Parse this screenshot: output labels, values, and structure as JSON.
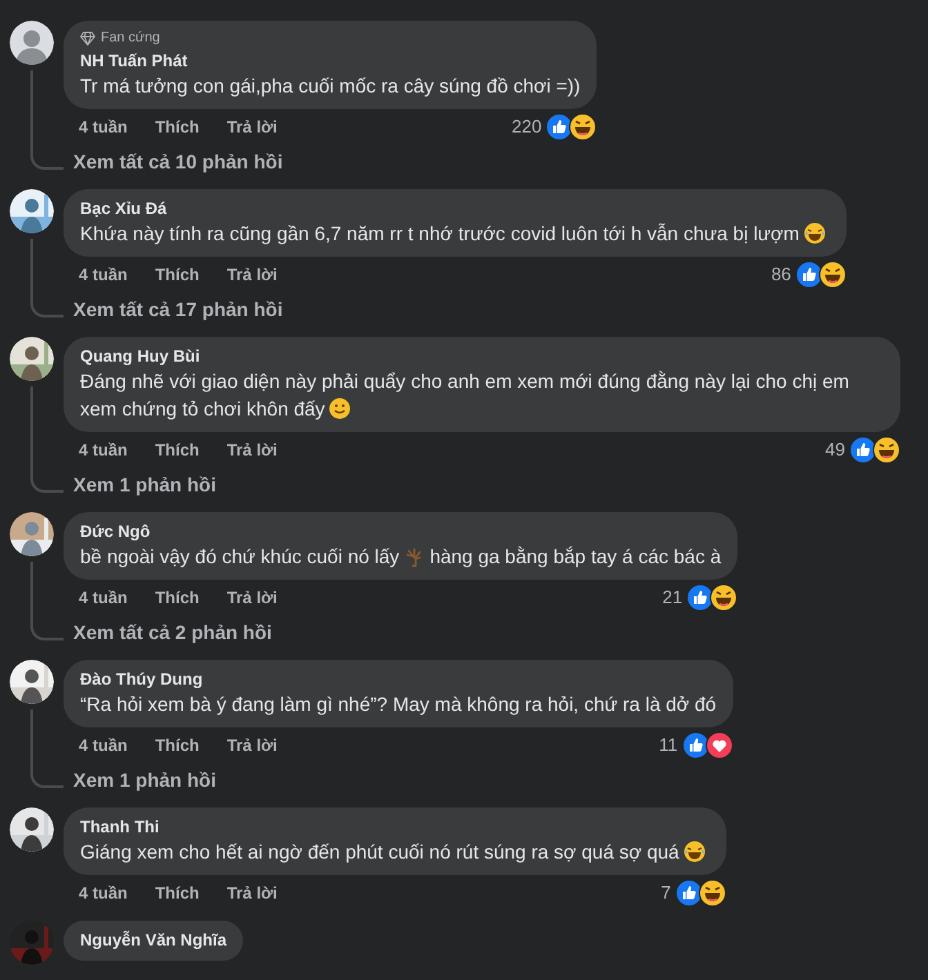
{
  "comments": [
    {
      "author": "NH Tuấn Phát",
      "avatar": {
        "kind": "silhouette"
      },
      "badge": "Fan cứng",
      "segments": [
        {
          "kind": "text",
          "text": "Tr má tưởng con gái,pha cuối mốc ra cây súng đồ chơi =))"
        }
      ],
      "time": "4 tuần",
      "like": "Thích",
      "reply": "Trả lời",
      "reaction_count": "220",
      "reactions": [
        {
          "kind": "like"
        },
        {
          "kind": "haha"
        }
      ],
      "replies_link": "Xem tất cả 10 phản hồi"
    },
    {
      "author": "Bạc Xỉu Đá",
      "avatar": {
        "kind": "picture"
      },
      "segments": [
        {
          "kind": "text",
          "text": "Khứa này tính ra cũng gần 6,7 năm rr t nhớ trước covid luôn tới h vẫn chưa bị lượm"
        },
        {
          "kind": "laugh-emoji"
        }
      ],
      "time": "4 tuần",
      "like": "Thích",
      "reply": "Trả lời",
      "reaction_count": "86",
      "reactions": [
        {
          "kind": "like"
        },
        {
          "kind": "haha"
        }
      ],
      "replies_link": "Xem tất cả 17 phản hồi"
    },
    {
      "author": "Quang Huy Bùi",
      "avatar": {
        "kind": "picture"
      },
      "segments": [
        {
          "kind": "text",
          "text": "Đáng nhẽ với giao diện này phải quẩy cho anh em xem mới đúng đằng này lại cho chị em xem chứng tỏ chơi khôn đấy"
        },
        {
          "kind": "smile-emoji"
        }
      ],
      "time": "4 tuần",
      "like": "Thích",
      "reply": "Trả lời",
      "reaction_count": "49",
      "reactions": [
        {
          "kind": "like"
        },
        {
          "kind": "haha"
        }
      ],
      "replies_link": "Xem 1 phản hồi"
    },
    {
      "author": "Đức Ngô",
      "avatar": {
        "kind": "picture"
      },
      "segments": [
        {
          "kind": "text",
          "text": "bề ngoài vậy đó chứ khúc cuối nó lấy"
        },
        {
          "kind": "tree-emoji"
        },
        {
          "kind": "text",
          "text": "hàng ga bằng bắp tay á các bác à"
        }
      ],
      "time": "4 tuần",
      "like": "Thích",
      "reply": "Trả lời",
      "reaction_count": "21",
      "reactions": [
        {
          "kind": "like"
        },
        {
          "kind": "haha"
        }
      ],
      "replies_link": "Xem tất cả 2 phản hồi"
    },
    {
      "author": "Đào Thúy Dung",
      "avatar": {
        "kind": "picture"
      },
      "segments": [
        {
          "kind": "text",
          "text": "“Ra hỏi xem bà ý đang làm gì nhé”? May mà không ra hỏi, chứ ra là dở đó"
        }
      ],
      "time": "4 tuần",
      "like": "Thích",
      "reply": "Trả lời",
      "reaction_count": "11",
      "reactions": [
        {
          "kind": "like"
        },
        {
          "kind": "love"
        }
      ],
      "replies_link": "Xem 1 phản hồi"
    },
    {
      "author": "Thanh Thi",
      "avatar": {
        "kind": "picture"
      },
      "segments": [
        {
          "kind": "text",
          "text": "Giáng xem cho hết ai ngờ đến phút cuối nó rút súng ra sợ quá sợ quá"
        },
        {
          "kind": "laugh-emoji"
        }
      ],
      "time": "4 tuần",
      "like": "Thích",
      "reply": "Trả lời",
      "reaction_count": "7",
      "reactions": [
        {
          "kind": "like"
        },
        {
          "kind": "haha"
        }
      ]
    },
    {
      "author": "Nguyễn Văn Nghĩa",
      "avatar": {
        "kind": "picture"
      }
    }
  ]
}
